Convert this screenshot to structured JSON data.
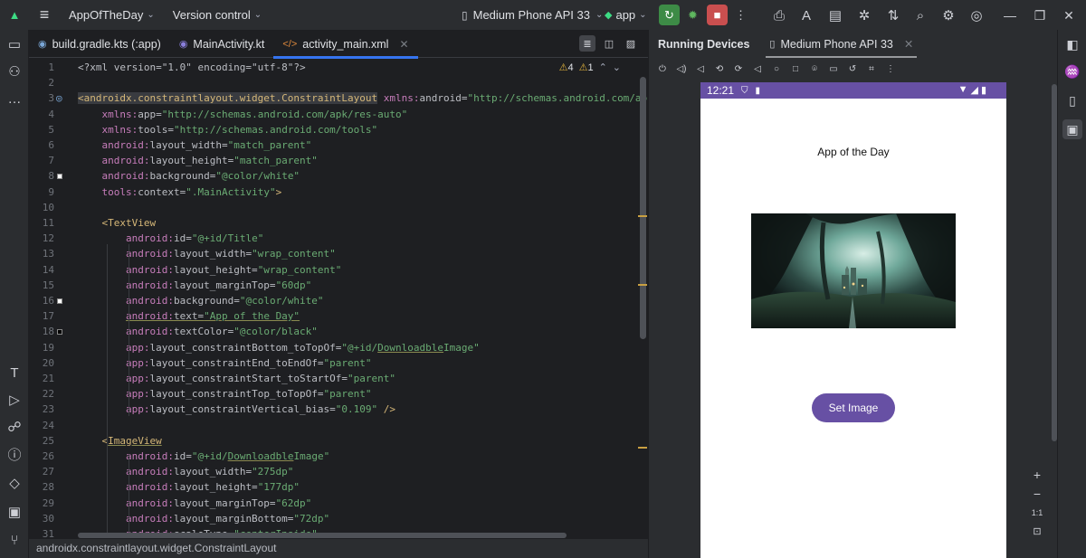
{
  "titlebar": {
    "project_name": "AppOfTheDay",
    "vcs_label": "Version control",
    "device": "Medium Phone API 33",
    "run_config": "app"
  },
  "editor": {
    "tabs": [
      {
        "label": "build.gradle.kts (:app)",
        "icon": "gradle-icon"
      },
      {
        "label": "MainActivity.kt",
        "icon": "kotlin-icon"
      },
      {
        "label": "activity_main.xml",
        "icon": "xml-icon"
      }
    ],
    "active_tab": 2,
    "warnings": "4",
    "errors": "1",
    "breadcrumb": "androidx.constraintlayout.widget.ConstraintLayout",
    "lines": [
      {
        "n": "1",
        "parts": [
          [
            "pi",
            "<?xml version=\"1.0\" encoding=\"utf-8\"?>"
          ]
        ]
      },
      {
        "n": "2",
        "parts": []
      },
      {
        "n": "3",
        "parts": [
          [
            "tag hlbg",
            "<androidx.constraintlayout.widget.ConstraintLayout"
          ],
          [
            "attr",
            " "
          ],
          [
            "ns",
            "xmlns:"
          ],
          [
            "attr",
            "android="
          ],
          [
            "str",
            "\"http://schemas.android.com/apk/res/"
          ]
        ]
      },
      {
        "n": "4",
        "parts": [
          [
            "attr",
            "    "
          ],
          [
            "ns",
            "xmlns:"
          ],
          [
            "attr",
            "app="
          ],
          [
            "str",
            "\"http://schemas.android.com/apk/res-auto\""
          ]
        ]
      },
      {
        "n": "5",
        "parts": [
          [
            "attr",
            "    "
          ],
          [
            "ns",
            "xmlns:"
          ],
          [
            "attr",
            "tools="
          ],
          [
            "str",
            "\"http://schemas.android.com/tools\""
          ]
        ]
      },
      {
        "n": "6",
        "parts": [
          [
            "attr",
            "    "
          ],
          [
            "ns",
            "android:"
          ],
          [
            "attr",
            "layout_width="
          ],
          [
            "str",
            "\"match_parent\""
          ]
        ]
      },
      {
        "n": "7",
        "parts": [
          [
            "attr",
            "    "
          ],
          [
            "ns",
            "android:"
          ],
          [
            "attr",
            "layout_height="
          ],
          [
            "str",
            "\"match_parent\""
          ]
        ]
      },
      {
        "n": "8",
        "parts": [
          [
            "attr",
            "    "
          ],
          [
            "ns",
            "android:"
          ],
          [
            "attr",
            "background="
          ],
          [
            "str",
            "\"@color/white\""
          ]
        ]
      },
      {
        "n": "9",
        "parts": [
          [
            "attr",
            "    "
          ],
          [
            "ns",
            "tools:"
          ],
          [
            "attr",
            "context="
          ],
          [
            "str",
            "\".MainActivity\""
          ],
          [
            "tag",
            ">"
          ]
        ]
      },
      {
        "n": "10",
        "parts": []
      },
      {
        "n": "11",
        "parts": [
          [
            "attr",
            "    "
          ],
          [
            "tag",
            "<TextView"
          ]
        ]
      },
      {
        "n": "12",
        "parts": [
          [
            "attr",
            "        "
          ],
          [
            "ns",
            "android:"
          ],
          [
            "attr",
            "id="
          ],
          [
            "str",
            "\"@+id/Title\""
          ]
        ]
      },
      {
        "n": "13",
        "parts": [
          [
            "attr",
            "        "
          ],
          [
            "ns",
            "android:"
          ],
          [
            "attr",
            "layout_width="
          ],
          [
            "str",
            "\"wrap_content\""
          ]
        ]
      },
      {
        "n": "14",
        "parts": [
          [
            "attr",
            "        "
          ],
          [
            "ns",
            "android:"
          ],
          [
            "attr",
            "layout_height="
          ],
          [
            "str",
            "\"wrap_content\""
          ]
        ]
      },
      {
        "n": "15",
        "parts": [
          [
            "attr",
            "        "
          ],
          [
            "ns",
            "android:"
          ],
          [
            "attr",
            "layout_marginTop="
          ],
          [
            "str",
            "\"60dp\""
          ]
        ]
      },
      {
        "n": "16",
        "parts": [
          [
            "attr",
            "        "
          ],
          [
            "ns",
            "android:"
          ],
          [
            "attr",
            "background="
          ],
          [
            "str",
            "\"@color/white\""
          ]
        ]
      },
      {
        "n": "17",
        "parts": [
          [
            "attr",
            "        "
          ],
          [
            "ns uline",
            "android:"
          ],
          [
            "attr uline",
            "text="
          ],
          [
            "str uline",
            "\"App of the Day\""
          ]
        ]
      },
      {
        "n": "18",
        "parts": [
          [
            "attr",
            "        "
          ],
          [
            "ns",
            "android:"
          ],
          [
            "attr",
            "textColor="
          ],
          [
            "str",
            "\"@color/black\""
          ]
        ]
      },
      {
        "n": "19",
        "parts": [
          [
            "attr",
            "        "
          ],
          [
            "ns",
            "app:"
          ],
          [
            "attr",
            "layout_constraintBottom_toTopOf="
          ],
          [
            "str",
            "\"@+id/"
          ],
          [
            "str uline",
            "Downloadble"
          ],
          [
            "str",
            "Image\""
          ]
        ]
      },
      {
        "n": "20",
        "parts": [
          [
            "attr",
            "        "
          ],
          [
            "ns",
            "app:"
          ],
          [
            "attr",
            "layout_constraintEnd_toEndOf="
          ],
          [
            "str",
            "\"parent\""
          ]
        ]
      },
      {
        "n": "21",
        "parts": [
          [
            "attr",
            "        "
          ],
          [
            "ns",
            "app:"
          ],
          [
            "attr",
            "layout_constraintStart_toStartOf="
          ],
          [
            "str",
            "\"parent\""
          ]
        ]
      },
      {
        "n": "22",
        "parts": [
          [
            "attr",
            "        "
          ],
          [
            "ns",
            "app:"
          ],
          [
            "attr",
            "layout_constraintTop_toTopOf="
          ],
          [
            "str",
            "\"parent\""
          ]
        ]
      },
      {
        "n": "23",
        "parts": [
          [
            "attr",
            "        "
          ],
          [
            "ns",
            "app:"
          ],
          [
            "attr",
            "layout_constraintVertical_bias="
          ],
          [
            "str",
            "\"0.109\""
          ],
          [
            "attr",
            " "
          ],
          [
            "tag",
            "/>"
          ]
        ]
      },
      {
        "n": "24",
        "parts": []
      },
      {
        "n": "25",
        "parts": [
          [
            "attr",
            "    "
          ],
          [
            "tag",
            "<"
          ],
          [
            "tag uline",
            "ImageView"
          ]
        ]
      },
      {
        "n": "26",
        "parts": [
          [
            "attr",
            "        "
          ],
          [
            "ns",
            "android:"
          ],
          [
            "attr",
            "id="
          ],
          [
            "str",
            "\"@+id/"
          ],
          [
            "str uline",
            "Downloadble"
          ],
          [
            "str",
            "Image\""
          ]
        ]
      },
      {
        "n": "27",
        "parts": [
          [
            "attr",
            "        "
          ],
          [
            "ns",
            "android:"
          ],
          [
            "attr",
            "layout_width="
          ],
          [
            "str",
            "\"275dp\""
          ]
        ]
      },
      {
        "n": "28",
        "parts": [
          [
            "attr",
            "        "
          ],
          [
            "ns",
            "android:"
          ],
          [
            "attr",
            "layout_height="
          ],
          [
            "str",
            "\"177dp\""
          ]
        ]
      },
      {
        "n": "29",
        "parts": [
          [
            "attr",
            "        "
          ],
          [
            "ns",
            "android:"
          ],
          [
            "attr",
            "layout_marginTop="
          ],
          [
            "str",
            "\"62dp\""
          ]
        ]
      },
      {
        "n": "30",
        "parts": [
          [
            "attr",
            "        "
          ],
          [
            "ns",
            "android:"
          ],
          [
            "attr",
            "layout_marginBottom="
          ],
          [
            "str",
            "\"72dp\""
          ]
        ]
      },
      {
        "n": "31",
        "parts": [
          [
            "attr",
            "        "
          ],
          [
            "ns",
            "android:"
          ],
          [
            "attr",
            "scaleType="
          ],
          [
            "str",
            "\"centerInside\""
          ]
        ]
      }
    ]
  },
  "running_devices": {
    "title": "Running Devices",
    "device_tab": "Medium Phone API 33",
    "zoom_ratio": "1:1"
  },
  "phone": {
    "time": "12:21",
    "app_title": "App of the Day",
    "button_label": "Set Image"
  },
  "colors": {
    "accent": "#6750a4",
    "editor_bg": "#1e1f22",
    "panel_bg": "#2b2d30",
    "run_green": "#3d8b46",
    "stop_red": "#c94f4f"
  }
}
